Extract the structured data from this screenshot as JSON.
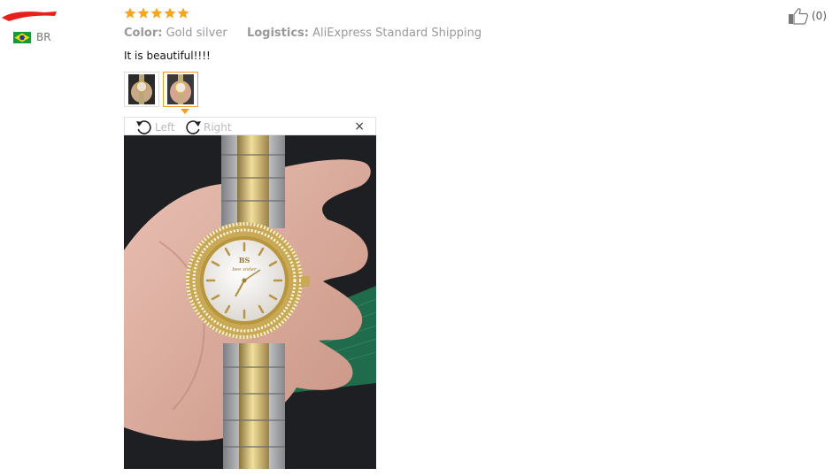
{
  "reviewer": {
    "country_code": "BR"
  },
  "rating": {
    "stars": 5,
    "max": 5,
    "color": "#f5a623"
  },
  "meta": {
    "color_label": "Color:",
    "color_value": "Gold silver",
    "logistics_label": "Logistics:",
    "logistics_value": "AliExpress Standard Shipping"
  },
  "review": {
    "text": "It is beautiful!!!!"
  },
  "viewer": {
    "rotate_left_label": "Left",
    "rotate_right_label": "Right",
    "close_label": "×"
  },
  "helpful": {
    "count": "(0)"
  },
  "colors": {
    "accent": "#f39c27",
    "redact": "#e8201a"
  },
  "icons": [
    "flag-brazil-icon",
    "star-icon",
    "rotate-left-icon",
    "rotate-right-icon",
    "close-icon",
    "thumbs-up-icon"
  ]
}
